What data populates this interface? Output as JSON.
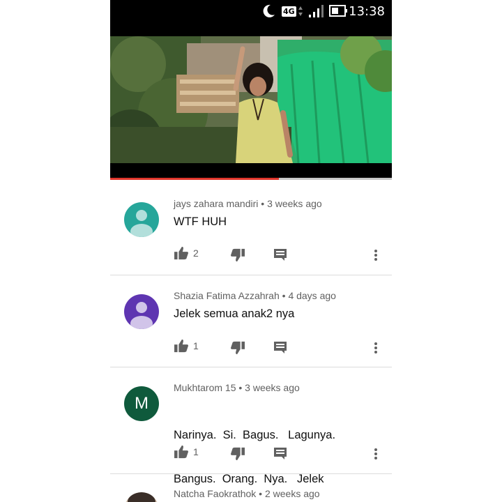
{
  "status_bar": {
    "network": "4G",
    "time": "13:38",
    "icons": [
      "moon-icon",
      "signal-icon",
      "battery-icon"
    ]
  },
  "video": {
    "progress_fraction": 0.6
  },
  "comments": [
    {
      "author": "jays zahara mandiri",
      "age": "3 weeks ago",
      "text": [
        "WTF HUH"
      ],
      "likes": "2",
      "avatar_color": "#26a69a"
    },
    {
      "author": "Shazia Fatima Azzahrah",
      "age": "4 days ago",
      "text": [
        "Jelek semua anak2 nya"
      ],
      "likes": "1",
      "avatar_color": "#5e35b1"
    },
    {
      "author": "Mukhtarom 15",
      "age": "3 weeks ago",
      "text": [
        "Narinya.  Si.  Bagus.   Lagunya.",
        "Bangus.  Orang.  Nya.   Jelek"
      ],
      "likes": "1",
      "avatar_letter": "M",
      "avatar_color": "#0f5a3c"
    },
    {
      "author": "Natcha Faokrathok",
      "age": "2 weeks ago",
      "avatar_color": "#3a2e28"
    }
  ],
  "separator": " • "
}
